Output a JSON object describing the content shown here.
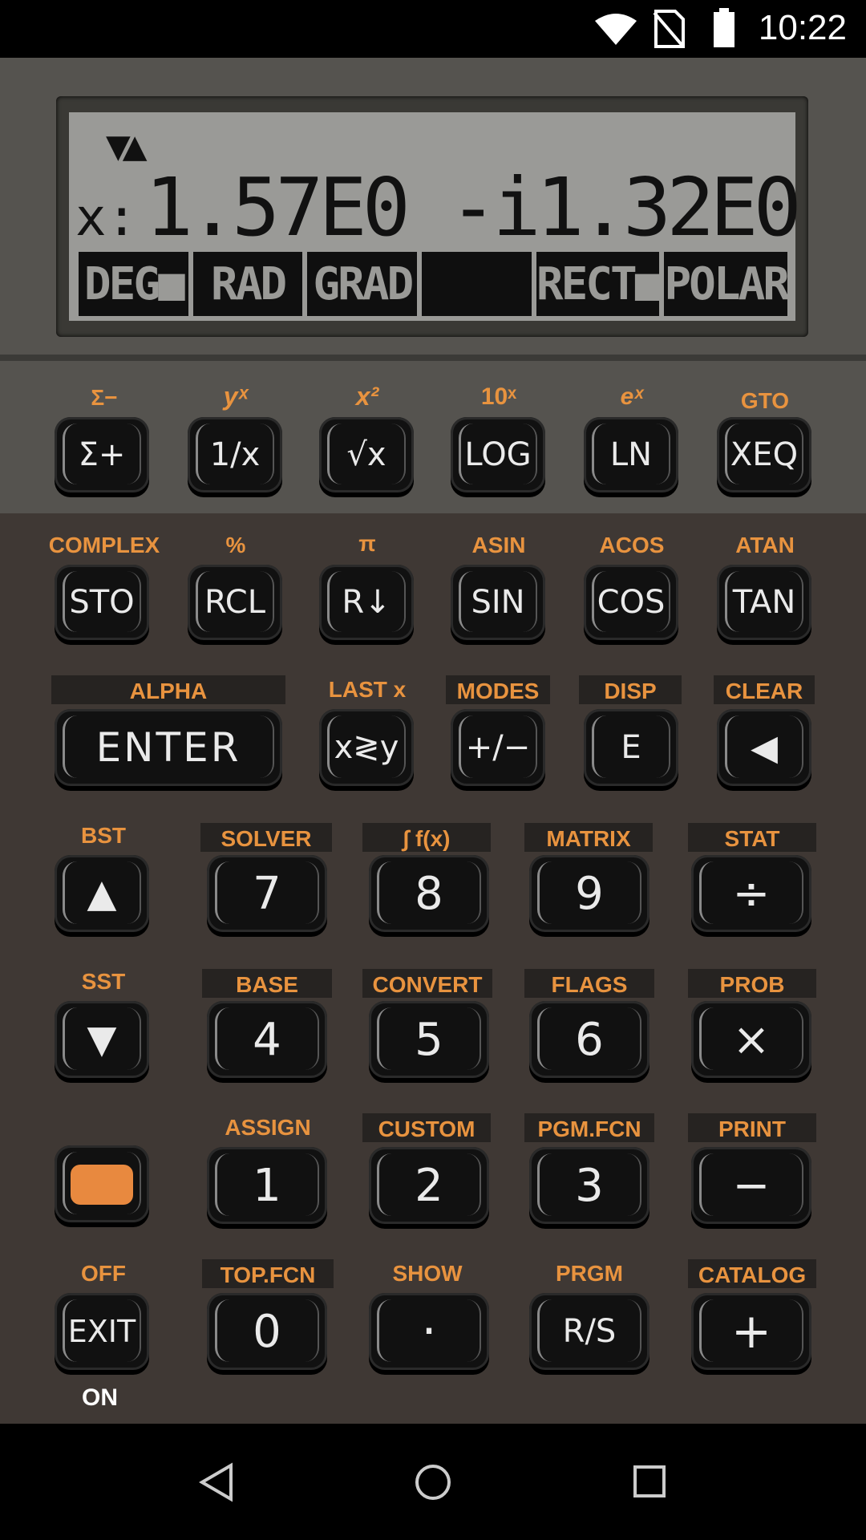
{
  "status_bar": {
    "time": "10:22"
  },
  "display": {
    "annunciator": "▼▲",
    "x_label": "x:",
    "x_value": "1.57E0 -i1.32E0",
    "menu": [
      "DEG■",
      "RAD",
      "GRAD",
      "",
      "RECT■",
      "POLAR"
    ]
  },
  "keys": {
    "sigma_plus": {
      "label": "Σ+",
      "shift": "Σ−"
    },
    "recip": {
      "label": "1/x",
      "shift": "yˣ"
    },
    "sqrt": {
      "label": "√x",
      "shift": "x²"
    },
    "log": {
      "label": "LOG",
      "shift": "10ˣ"
    },
    "ln": {
      "label": "LN",
      "shift": "eˣ"
    },
    "xeq": {
      "label": "XEQ",
      "shift": "GTO"
    },
    "sto": {
      "label": "STO",
      "shift": "COMPLEX"
    },
    "rcl": {
      "label": "RCL",
      "shift": "%"
    },
    "rdown": {
      "label": "R↓",
      "shift": "π"
    },
    "sin": {
      "label": "SIN",
      "shift": "ASIN"
    },
    "cos": {
      "label": "COS",
      "shift": "ACOS"
    },
    "tan": {
      "label": "TAN",
      "shift": "ATAN"
    },
    "enter": {
      "label": "ENTER",
      "shift": "ALPHA"
    },
    "swap": {
      "label": "x≷y",
      "shift": "LAST x"
    },
    "chs": {
      "label": "+/−",
      "shift": "MODES"
    },
    "e": {
      "label": "E",
      "shift": "DISP"
    },
    "back": {
      "label": "◀",
      "shift": "CLEAR"
    },
    "up": {
      "label": "▲",
      "shift": "BST"
    },
    "k7": {
      "label": "7",
      "shift": "SOLVER"
    },
    "k8": {
      "label": "8",
      "shift": "∫ f(x)"
    },
    "k9": {
      "label": "9",
      "shift": "MATRIX"
    },
    "div": {
      "label": "÷",
      "shift": "STAT"
    },
    "down": {
      "label": "▼",
      "shift": "SST"
    },
    "k4": {
      "label": "4",
      "shift": "BASE"
    },
    "k5": {
      "label": "5",
      "shift": "CONVERT"
    },
    "k6": {
      "label": "6",
      "shift": "FLAGS"
    },
    "mul": {
      "label": "×",
      "shift": "PROB"
    },
    "k1": {
      "label": "1",
      "shift": "ASSIGN"
    },
    "k2": {
      "label": "2",
      "shift": "CUSTOM"
    },
    "k3": {
      "label": "3",
      "shift": "PGM.FCN"
    },
    "sub": {
      "label": "−",
      "shift": "PRINT"
    },
    "exit": {
      "label": "EXIT",
      "shift": "OFF",
      "below": "ON"
    },
    "k0": {
      "label": "0",
      "shift": "TOP.FCN"
    },
    "dot": {
      "label": "·",
      "shift": "SHOW"
    },
    "rs": {
      "label": "R/S",
      "shift": "PRGM"
    },
    "add": {
      "label": "+",
      "shift": "CATALOG"
    }
  },
  "colors": {
    "accent": "#e8893f",
    "shift_text": "#e8933f",
    "lcd": "#9a9a97",
    "body": "#3f3834",
    "upper_body": "#55534f"
  }
}
